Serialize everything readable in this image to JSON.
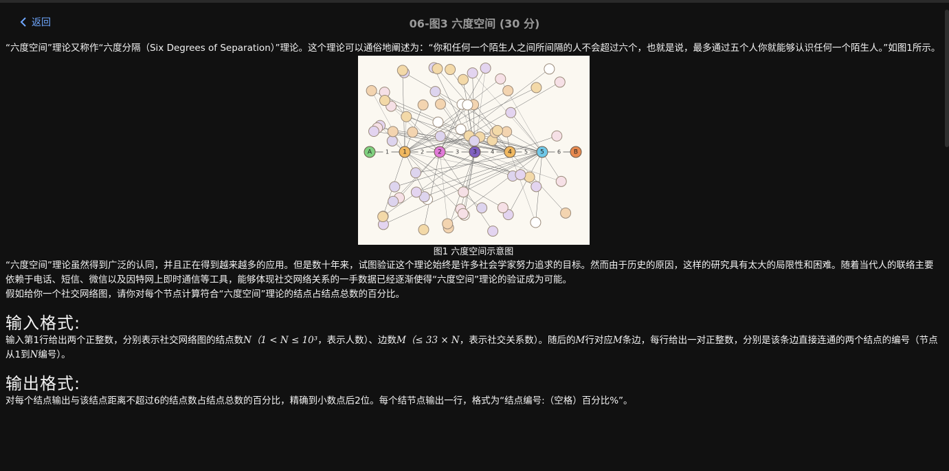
{
  "header": {
    "back_label": "返回",
    "title": "06-图3 六度空间 (30 分)"
  },
  "content": {
    "para1": "“六度空间”理论又称作“六度分隔（Six Degrees of Separation）”理论。这个理论可以通俗地阐述为：“你和任何一个陌生人之间所间隔的人不会超过六个，也就是说，最多通过五个人你就能够认识任何一个陌生人。”如图1所示。",
    "figure_caption": "图1 六度空间示意图",
    "para2": "“六度空间”理论虽然得到广泛的认同，并且正在得到越来越多的应用。但是数十年来，试图验证这个理论始终是许多社会学家努力追求的目标。然而由于历史的原因，这样的研究具有太大的局限性和困难。随着当代人的联络主要依赖于电话、短信、微信以及因特网上即时通信等工具，能够体现社交网络关系的一手数据已经逐渐使得“六度空间”理论的验证成为可能。",
    "para3": "假如给你一个社交网络图，请你对每个节点计算符合“六度空间”理论的结点占结点总数的百分比。",
    "input_heading": "输入格式:",
    "input_text_a": "输入第1行给出两个正整数，分别表示社交网络图的结点数",
    "input_math_a": "N（1 < N ≤ 10³",
    "input_text_b": "，表示人数）、边数",
    "input_math_b": "M（≤ 33 × N",
    "input_text_c": "，表示社交关系数）。随后的",
    "input_math_c": "M",
    "input_text_d": "行对应",
    "input_math_d": "M",
    "input_text_e": "条边，每行给出一对正整数，分别是该条边直接连通的两个结点的编号（节点从1到",
    "input_math_e": "N",
    "input_text_f": "编号）。",
    "output_heading": "输出格式:",
    "output_text": "对每个结点输出与该结点距离不超过6的结点数占结点总数的百分比，精确到小数点后2位。每个结节点输出一行，格式为“结点编号:（空格）百分比%”。"
  },
  "figure": {
    "main_chain": [
      "A",
      "1",
      "2",
      "3",
      "4",
      "5",
      "B"
    ],
    "edge_labels": [
      "1",
      "2",
      "3",
      "4",
      "5",
      "6"
    ],
    "colors": {
      "A": "#7fd07f",
      "1": "#f0b860",
      "2": "#e07ad8",
      "3": "#8060c0",
      "4": "#f0b860",
      "5": "#70c8e8",
      "B": "#e88a50"
    }
  }
}
